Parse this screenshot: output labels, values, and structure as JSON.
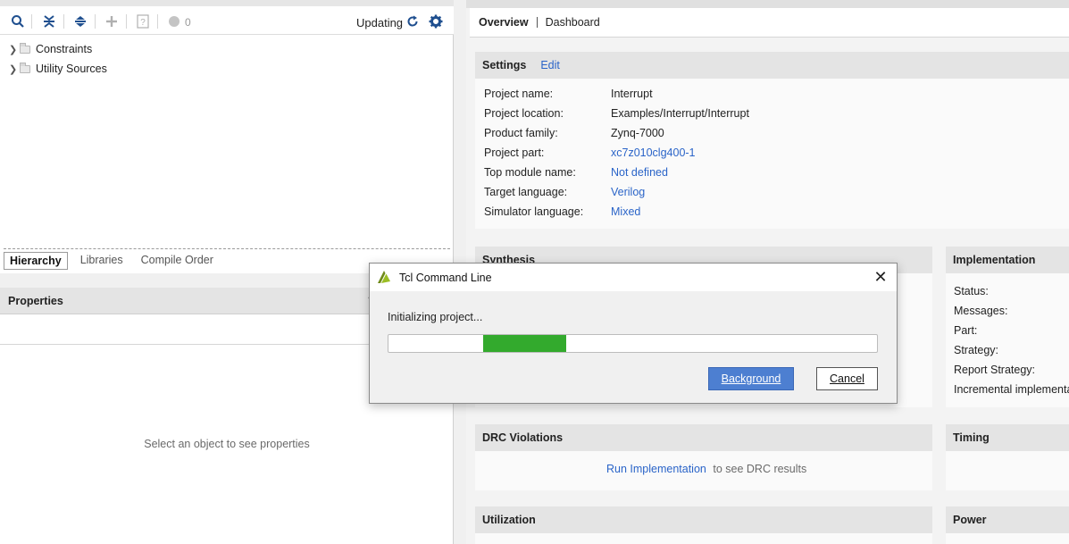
{
  "sources": {
    "toolbar": {
      "search_icon": "search-icon",
      "collapse_all_icon": "collapse-all-icon",
      "expand_all_icon": "expand-all-icon",
      "add_icon": "plus-icon",
      "help_icon": "question-icon",
      "status_count": "0",
      "updating_label": "Updating",
      "refresh_icon": "refresh-icon",
      "settings_icon": "gear-icon"
    },
    "tree": [
      {
        "label": "Constraints"
      },
      {
        "label": "Utility Sources"
      }
    ],
    "tabs": [
      {
        "label": "Hierarchy",
        "active": true
      },
      {
        "label": "Libraries",
        "active": false
      },
      {
        "label": "Compile Order",
        "active": false
      }
    ]
  },
  "properties": {
    "title": "Properties",
    "help": "?",
    "empty_message": "Select an object to see properties"
  },
  "summary": {
    "tabs": [
      {
        "label": "Overview",
        "active": true
      },
      {
        "label": "Dashboard",
        "active": false
      }
    ],
    "settings": {
      "title": "Settings",
      "edit_label": "Edit",
      "rows": [
        {
          "key": "Project name:",
          "value": "Interrupt",
          "is_link": false
        },
        {
          "key": "Project location:",
          "value": "Examples/Interrupt/Interrupt",
          "is_link": false
        },
        {
          "key": "Product family:",
          "value": "Zynq-7000",
          "is_link": false
        },
        {
          "key": "Project part:",
          "value": "xc7z010clg400-1",
          "is_link": true
        },
        {
          "key": "Top module name:",
          "value": "Not defined",
          "is_link": true
        },
        {
          "key": "Target language:",
          "value": "Verilog",
          "is_link": true
        },
        {
          "key": "Simulator language:",
          "value": "Mixed",
          "is_link": true
        }
      ]
    },
    "synthesis": {
      "title": "Synthesis"
    },
    "implementation": {
      "title": "Implementation",
      "rows": [
        "Status:",
        "Messages:",
        "Part:",
        "Strategy:",
        "Report Strategy:",
        "Incremental implementa"
      ]
    },
    "drc": {
      "title": "DRC Violations",
      "link": "Run Implementation",
      "text": "to see DRC results"
    },
    "timing": {
      "title": "Timing"
    },
    "utilization": {
      "title": "Utilization"
    },
    "power": {
      "title": "Power"
    }
  },
  "dialog": {
    "title": "Tcl Command Line",
    "message": "Initializing project...",
    "progress_fraction": 0.17,
    "background_label": "Background",
    "cancel_label": "Cancel",
    "colors": {
      "progress": "#33aa2d",
      "primary_button": "#4d7fd1"
    }
  }
}
